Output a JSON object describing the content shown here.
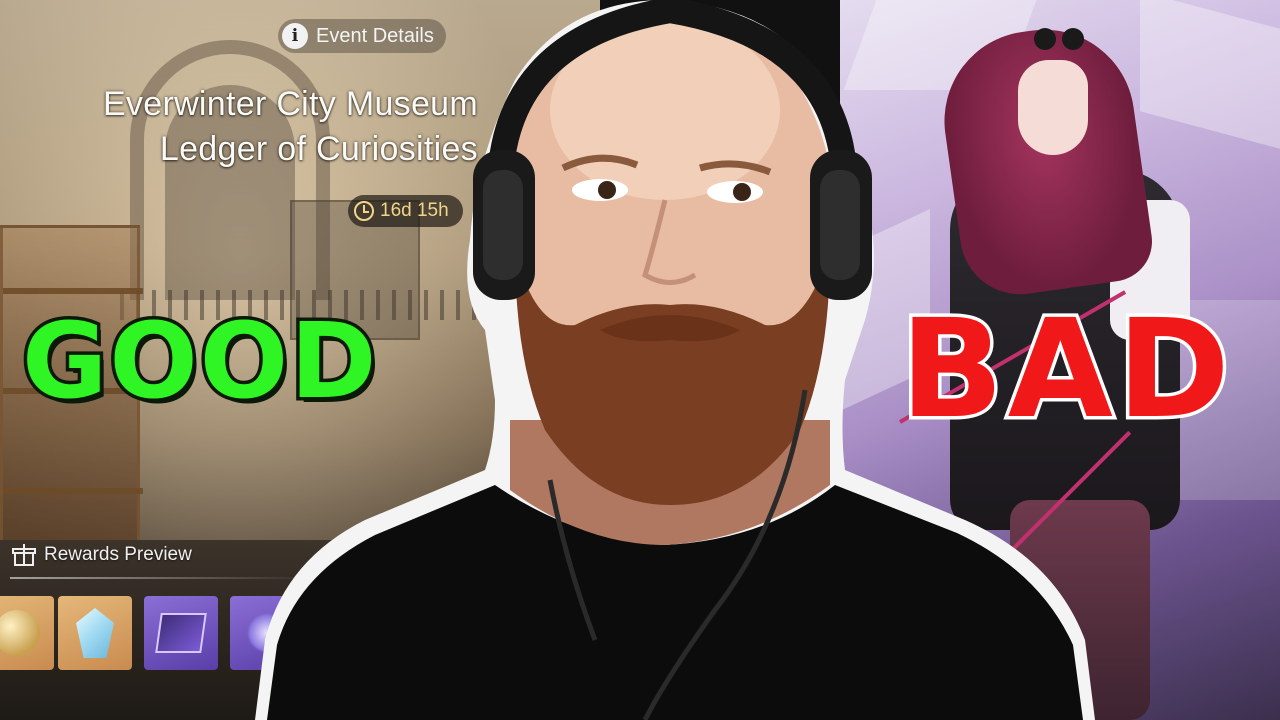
{
  "event_panel": {
    "event_details_label": "Event Details",
    "title_line1": "Everwinter City Museum",
    "title_line2": "Ledger of Curiosities",
    "timer": "16d 15h",
    "rewards_label": "Rewards Preview"
  },
  "overlay": {
    "good_text": "GOOD",
    "bad_text": "BAD",
    "good_color": "#2ff525",
    "bad_color": "#f01818"
  },
  "icons": [
    "info-icon",
    "clock-icon",
    "gift-icon"
  ]
}
